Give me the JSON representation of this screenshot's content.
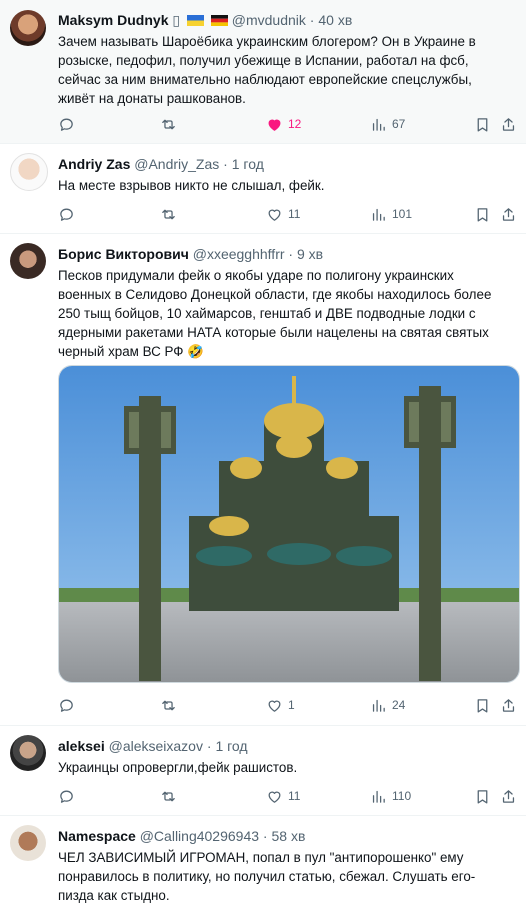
{
  "colors": {
    "like_active": "#f91880",
    "muted_text": "#536471",
    "border": "#eff3f4"
  },
  "icons": {
    "reply": "reply-icon",
    "repost": "repost-icon",
    "like": "heart-icon",
    "views": "views-icon",
    "bookmark": "bookmark-icon",
    "share": "share-icon"
  },
  "posts": [
    {
      "name": "Maksym Dudnyk",
      "name_symbol": "▯",
      "flags": [
        "Ukraine flag",
        "Germany flag"
      ],
      "handle": "@mvdudnik",
      "sep": "·",
      "time": "40 хв",
      "text": "Зачем называть Шароёбика украинским блогером? Он в Украине в розыске, педофил, получил убежище в Испании, работал на фсб, сейчас за ним внимательно наблюдают европейские спецслужбы, живёт на донаты рашкованов.",
      "replies": "",
      "reposts": "",
      "likes": "12",
      "liked": true,
      "views": "67"
    },
    {
      "name": "Andriy Zas",
      "handle": "@Andriy_Zas",
      "sep": "·",
      "time": "1 год",
      "text": "На месте взрывов никто не слышал, фейк.",
      "replies": "",
      "reposts": "",
      "likes": "11",
      "views": "101"
    },
    {
      "name": "Борис Викторович",
      "handle": "@xxeegghhffrr",
      "sep": "·",
      "time": "9 хв",
      "text": "Песков придумали фейк о якобы ударе по полигону украинских военных в Селидово Донецкой области, где якобы находилось более 250 тыщ бойцов, 10 хаймарсов, генштаб и ДВЕ подводные лодки с ядерными ракетами НАТА которые были нацелены на святая святых черный храм ВС РФ 🤣",
      "media": "Photo of a large green-domed cathedral with tall lantern columns on a paved plaza",
      "replies": "",
      "reposts": "",
      "likes": "1",
      "views": "24"
    },
    {
      "name": "aleksei",
      "handle": "@alekseixazov",
      "sep": "·",
      "time": "1 год",
      "text": "Украинцы опровергли,фейк рашистов.",
      "replies": "",
      "reposts": "",
      "likes": "11",
      "views": "110"
    },
    {
      "name": "Namespace",
      "handle": "@Calling40296943",
      "sep": "·",
      "time": "58 хв",
      "text": "ЧЕЛ ЗАВИСИМЫЙ ИГРОМАН, попал в пул \"антипорошенко\" ему понравилось в политику, но получил статью, сбежал. Слушать его- пизда как стыдно."
    }
  ]
}
